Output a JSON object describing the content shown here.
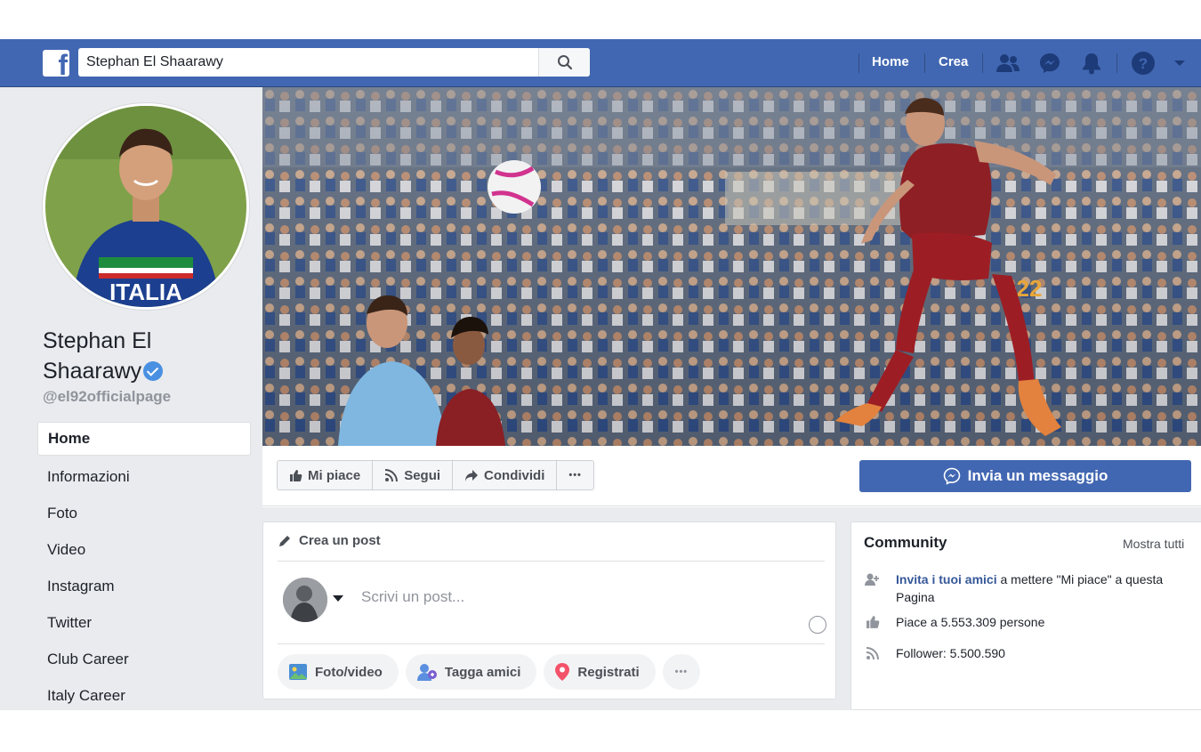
{
  "topbar": {
    "logo_text": "f",
    "search_value": "Stephan El Shaarawy",
    "nav_home": "Home",
    "nav_create": "Crea",
    "icons": [
      "friends-icon",
      "messenger-icon",
      "notifications-icon",
      "help-icon",
      "caret-down-icon"
    ],
    "colors": {
      "bar": "#4267b2",
      "page_bg": "#e9ebee"
    }
  },
  "profile": {
    "name": "Stephan El Shaarawy",
    "handle": "@el92officialpage",
    "nav": [
      "Home",
      "Informazioni",
      "Foto",
      "Video",
      "Instagram",
      "Twitter",
      "Club Career",
      "Italy Career"
    ]
  },
  "actions": {
    "like": "Mi piace",
    "follow": "Segui",
    "share": "Condividi",
    "more": "•••",
    "message": "Invia un messaggio"
  },
  "post": {
    "header": "Crea un post",
    "placeholder": "Scrivi un post...",
    "buttons": [
      "Foto/video",
      "Tagga amici",
      "Registrati"
    ],
    "more": "•••"
  },
  "community": {
    "title": "Community",
    "see_all": "Mostra tutti",
    "invite_link": "Invita i tuoi amici",
    "invite_rest": " a mettere \"Mi piace\" a questa Pagina",
    "likes": "Piace a 5.553.309 persone",
    "followers": "Follower: 5.500.590"
  }
}
